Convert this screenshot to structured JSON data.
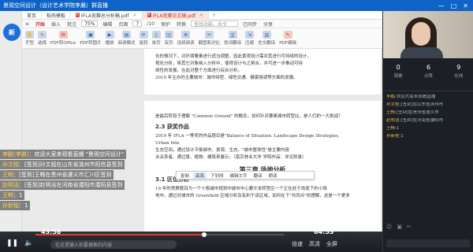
{
  "window": {
    "title": "景观空间设计（设计艺术学院李晨）群直播",
    "controls": [
      "—",
      "□",
      "✕"
    ]
  },
  "app": {
    "logo_text": "新"
  },
  "tabs": [
    {
      "label": "首页",
      "active": false
    },
    {
      "label": "稻壳模板",
      "active": false
    },
    {
      "label": "IFLA竞赛总分析稿.pdf",
      "active": false
    },
    {
      "label": "IFLA竞赛论文稿.pdf",
      "active": true
    }
  ],
  "menubar": {
    "items": [
      "首页",
      "插入",
      "批注",
      "编辑",
      "页面",
      "保护",
      "转换"
    ],
    "active_item": "开始",
    "zoom": "75%",
    "page_current": "7",
    "page_total": "/10",
    "search_placeholder": "查找功能、命令",
    "share": "分享",
    "sync": "已同步"
  },
  "ribbon": {
    "buttons": [
      {
        "label": "手型",
        "icon": "hand-icon"
      },
      {
        "label": "选择",
        "icon": "cursor-icon"
      },
      {
        "label": "PDF转Office",
        "icon": "pdf-convert-icon"
      },
      {
        "label": "PDF转图片",
        "icon": "image-icon"
      },
      {
        "label": "播放",
        "icon": "play-icon"
      },
      {
        "label": "阅读模式",
        "icon": "read-mode-icon"
      },
      {
        "label": "旋转",
        "icon": "rotate-icon"
      },
      {
        "label": "单页",
        "icon": "single-page-icon"
      },
      {
        "label": "双页",
        "icon": "double-page-icon"
      },
      {
        "label": "连续阅读",
        "icon": "continuous-icon"
      },
      {
        "label": "截图和对比",
        "icon": "screenshot-icon"
      },
      {
        "label": "划词翻译",
        "icon": "translate-icon"
      },
      {
        "label": "压缩",
        "icon": "compress-icon"
      },
      {
        "label": "全文翻译",
        "icon": "full-translate-icon"
      },
      {
        "label": "PDF编辑",
        "icon": "pdf-edit-icon"
      }
    ]
  },
  "document": {
    "page1_lines": [
      "化的情况下，对环境要素进行适当调整，因此景观设计需对其进行可持续的设计，",
      "视化分析，将其它对象纳入分析中，使得设计与之契合，并可进一步推动可持",
      "续性的发展。在此对整个方面进行综合分析。",
      "2019 年主办的主要城市：城市特型、绿色交通、健康强调等方面的发展。"
    ],
    "page2_intro": "是最后阶段于理解 \"Common Ground\" 的概念，如何针对要素城市转型比，是人们的一大挑战？",
    "section_2_3": "2.3 获奖作品",
    "award_text_1": "2019 年 IFLA 一等奖的作品题目是\"Balance of Situation: Landscape Design Strategies,",
    "award_text_2": "Urban Inte",
    "award_text_3": "生态空间，通过设计平衡城市、景观、生态，\"城市整体性\"是主要内容",
    "award_text_4": "业关系者、通过景、植物、建筑来展示。（南京林业大学 学院作品：详见附录）",
    "chapter": "第三章   场地分析",
    "section_3_1": "3.1 区位分析",
    "loc_text_1": "19 年的竞赛题目为一个十极城市规划中城市中心要文本转型区一个正在处于改造下的小场",
    "loc_text_2": "地中。通过对城市的 Greenfield 区域分析及有利于该区域，如何在下\"共同点\"的理解，这是一个更多"
  },
  "float_toolbar": [
    "复制",
    "高亮",
    "下划线",
    "编辑文字",
    "翻译",
    "朗读"
  ],
  "player": {
    "current_time": "43:58",
    "total_time": "64:53",
    "progress": 0.678,
    "danmu_placeholder": "在这里输入你要搜索的内容",
    "right_controls": [
      "倍速",
      "高清",
      "全屏"
    ]
  },
  "chat": [
    {
      "name": "李鹏(李鹏)",
      "text": "欢迎大家来观看直播 \"景观空间设计\"",
      "highlight": true
    },
    {
      "name": "孙文程",
      "text": "[签到]孙文程在山东省滨州市阳信县签到",
      "highlight": false
    },
    {
      "name": "王畅",
      "text": "[签到]王畅在贵州省遵义市汇川区签到",
      "highlight": false
    },
    {
      "name": "赵明洁",
      "text": "[签到]赵明洁在河南省濮阳市濮阳县签到",
      "highlight": false
    },
    {
      "name": "王畅",
      "text": "1",
      "highlight": false
    },
    {
      "name": "孙新程",
      "text": "1",
      "highlight": false
    }
  ],
  "right_panel": {
    "stats": [
      {
        "num": "0",
        "label": "观看"
      },
      {
        "num": "6",
        "label": "点赞"
      },
      {
        "num": "9",
        "label": "在线"
      }
    ],
    "messages": [
      {
        "name": "李鹏:",
        "text": "欢迎大家来观看直播"
      },
      {
        "name": "孙文程:",
        "text": "[签到]在山东省滨州市"
      },
      {
        "name": "王畅:",
        "text": "[签到]在贵州省遵义市"
      },
      {
        "name": "赵明洁:",
        "text": "[签到]在河南省濮阳市"
      },
      {
        "name": "王畅:",
        "text": "1"
      },
      {
        "name": "孙新程:",
        "text": "1"
      }
    ]
  }
}
